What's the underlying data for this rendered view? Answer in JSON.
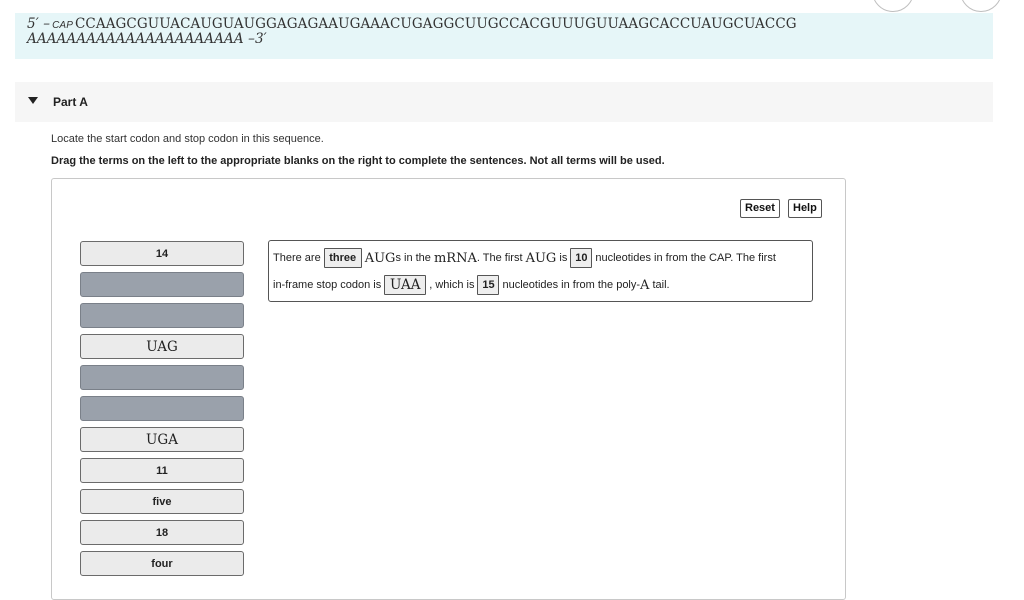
{
  "sequence": {
    "prefix": "5′ –",
    "cap": "CAP",
    "nucleotides": "CCAAGCGUUACAUGUAUGGAGAGAAUGAAACUGAGGCUUGCCACGUUUGUUAAGCACCUAUGCUACCG",
    "poly_a": "AAAAAAAAAAAAAAAAAAAAAA",
    "suffix": "–3′"
  },
  "part": {
    "title": "Part A"
  },
  "instructions": {
    "line1": "Locate the start codon and stop codon in this sequence.",
    "line2": "Drag the terms on the left to the appropriate blanks on the right to complete the sentences. Not all terms will be used."
  },
  "toolbar": {
    "reset_label": "Reset",
    "help_label": "Help"
  },
  "terms": [
    "14",
    "",
    "",
    "UAG",
    "",
    "",
    "UGA",
    "11",
    "five",
    "18",
    "four"
  ],
  "sentence": {
    "p1": "There are",
    "blank1": "three",
    "p2_math": "AUG",
    "p2_tail": "s in the",
    "p2_mrna": "mRNA",
    "p2_end": ". The first",
    "p3_math": "AUG",
    "p3_is": "is",
    "blank2": "10",
    "p4": "nucleotides in from the CAP. The first",
    "p5": "in-frame stop codon is",
    "blank3": "UAA",
    "p6": ", which is",
    "blank4": "15",
    "p7": "nucleotides in from the poly-",
    "p7_math": "A",
    "p7_end": "tail."
  },
  "colors": {
    "sequence_bg": "#e6f6f8",
    "empty_tile": "#9aa1ab",
    "tile": "#ebebeb"
  }
}
